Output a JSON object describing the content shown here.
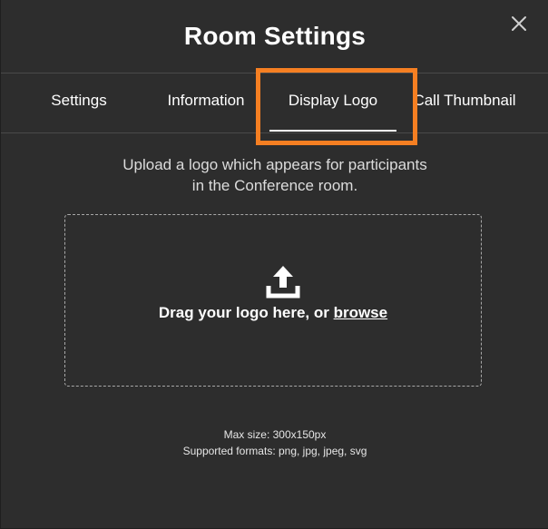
{
  "dialog": {
    "title": "Room Settings",
    "close_icon": "close-icon"
  },
  "tabs": [
    {
      "label": "Settings",
      "active": false
    },
    {
      "label": "Information",
      "active": false
    },
    {
      "label": "Display Logo",
      "active": true
    },
    {
      "label": "Call Thumbnail",
      "active": false
    }
  ],
  "content": {
    "description_line1": "Upload a logo which appears for participants",
    "description_line2": "in the Conference room.",
    "dropzone": {
      "icon": "upload-icon",
      "text_prefix": "Drag your logo here, or ",
      "browse_label": "browse"
    },
    "max_size": "Max size: 300x150px",
    "supported_formats": "Supported formats: png, jpg, jpeg, svg"
  },
  "colors": {
    "background": "#2d2d2d",
    "highlight": "#f57f22",
    "text": "#ffffff"
  }
}
